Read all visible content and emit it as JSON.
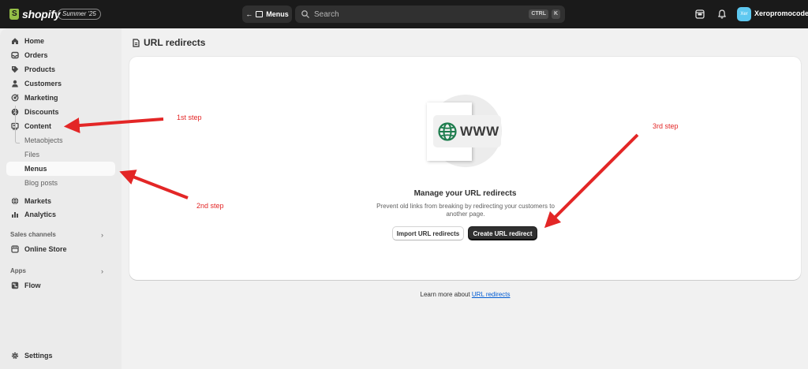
{
  "topbar": {
    "brand": "shopify",
    "edition_badge": "Summer '25",
    "back_button_label": "Menus",
    "search_placeholder": "Search",
    "shortcut_ctrl": "CTRL",
    "shortcut_key": "K",
    "avatar_initials": "Xer",
    "store_name": "Xeropromocode",
    "colors": {
      "bar_bg": "#1a1a1a",
      "avatar_bg": "#5ec8f0"
    }
  },
  "sidebar": {
    "items": [
      {
        "label": "Home",
        "icon": "home-icon"
      },
      {
        "label": "Orders",
        "icon": "inbox-icon"
      },
      {
        "label": "Products",
        "icon": "tag-icon"
      },
      {
        "label": "Customers",
        "icon": "person-icon"
      },
      {
        "label": "Marketing",
        "icon": "target-icon"
      },
      {
        "label": "Discounts",
        "icon": "discount-icon"
      },
      {
        "label": "Content",
        "icon": "content-icon"
      }
    ],
    "content_subitems": [
      {
        "label": "Metaobjects"
      },
      {
        "label": "Files"
      },
      {
        "label": "Menus",
        "active": true
      },
      {
        "label": "Blog posts"
      }
    ],
    "items_after": [
      {
        "label": "Markets",
        "icon": "globe-icon"
      },
      {
        "label": "Analytics",
        "icon": "bar-chart-icon"
      }
    ],
    "sales_channels_label": "Sales channels",
    "online_store_label": "Online Store",
    "apps_label": "Apps",
    "flow_label": "Flow",
    "settings_label": "Settings"
  },
  "main": {
    "page_title": "URL redirects",
    "empty_state": {
      "illustration_text": "WWW",
      "heading": "Manage your URL redirects",
      "description": "Prevent old links from breaking by redirecting your customers to another page.",
      "secondary_button": "Import URL redirects",
      "primary_button": "Create URL redirect"
    },
    "learn_more_prefix": "Learn more about",
    "learn_more_link": "URL redirects"
  },
  "annotations": {
    "step1": "1st step",
    "step2": "2nd step",
    "step3": "3rd step",
    "color": "#e32626"
  }
}
